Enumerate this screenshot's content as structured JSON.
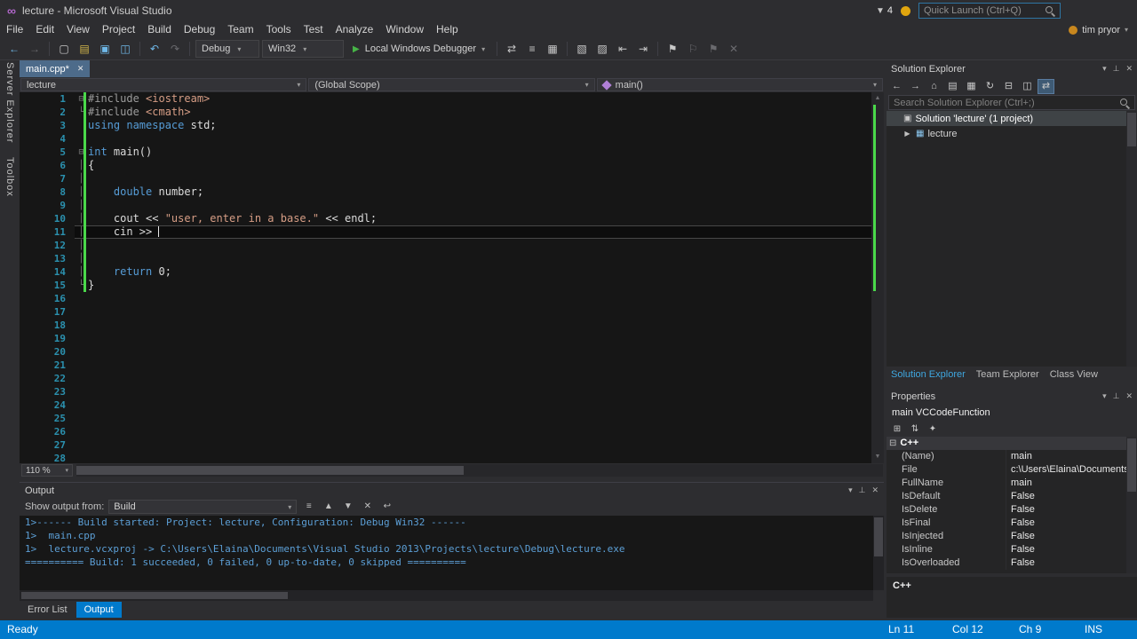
{
  "title_bar": {
    "title": "lecture - Microsoft Visual Studio",
    "notif_count": "4",
    "quick_launch_placeholder": "Quick Launch (Ctrl+Q)"
  },
  "menu": {
    "items": [
      "File",
      "Edit",
      "View",
      "Project",
      "Build",
      "Debug",
      "Team",
      "Tools",
      "Test",
      "Analyze",
      "Window",
      "Help"
    ],
    "user": "tim pryor"
  },
  "toolbar": {
    "debug_config": "Debug",
    "platform": "Win32",
    "run_label": "Local Windows Debugger"
  },
  "side_tabs": [
    "Server Explorer",
    "Toolbox"
  ],
  "editor": {
    "tab": "main.cpp*",
    "nav": {
      "project": "lecture",
      "scope": "(Global Scope)",
      "member": "main()"
    },
    "zoom": "110 %",
    "lines": [
      {
        "n": 1,
        "fold": "box",
        "seg": [
          {
            "t": "#include ",
            "c": "pp"
          },
          {
            "t": "<iostream>",
            "c": "str"
          }
        ]
      },
      {
        "n": 2,
        "fold": "end",
        "seg": [
          {
            "t": "#include ",
            "c": "pp"
          },
          {
            "t": "<cmath>",
            "c": "str"
          }
        ]
      },
      {
        "n": 3,
        "fold": "",
        "seg": [
          {
            "t": "using",
            "c": "kw"
          },
          {
            "t": " ",
            "c": "pl"
          },
          {
            "t": "namespace",
            "c": "kw"
          },
          {
            "t": " std;",
            "c": "pl"
          }
        ]
      },
      {
        "n": 4,
        "fold": "",
        "seg": []
      },
      {
        "n": 5,
        "fold": "box",
        "seg": [
          {
            "t": "int",
            "c": "kw"
          },
          {
            "t": " main()",
            "c": "pl"
          }
        ]
      },
      {
        "n": 6,
        "fold": "line",
        "seg": [
          {
            "t": "{",
            "c": "pl"
          }
        ]
      },
      {
        "n": 7,
        "fold": "line",
        "seg": []
      },
      {
        "n": 8,
        "fold": "line",
        "seg": [
          {
            "t": "    ",
            "c": "pl"
          },
          {
            "t": "double",
            "c": "kw"
          },
          {
            "t": " number;",
            "c": "pl"
          }
        ]
      },
      {
        "n": 9,
        "fold": "line",
        "seg": []
      },
      {
        "n": 10,
        "fold": "line",
        "seg": [
          {
            "t": "    cout << ",
            "c": "pl"
          },
          {
            "t": "\"user, enter in a base.\"",
            "c": "str"
          },
          {
            "t": " << endl;",
            "c": "pl"
          }
        ]
      },
      {
        "n": 11,
        "fold": "line",
        "current": true,
        "seg": [
          {
            "t": "    cin >> ",
            "c": "pl"
          }
        ]
      },
      {
        "n": 12,
        "fold": "line",
        "seg": []
      },
      {
        "n": 13,
        "fold": "line",
        "seg": []
      },
      {
        "n": 14,
        "fold": "line",
        "seg": [
          {
            "t": "    ",
            "c": "pl"
          },
          {
            "t": "return",
            "c": "kw"
          },
          {
            "t": " 0;",
            "c": "pl"
          }
        ]
      },
      {
        "n": 15,
        "fold": "end",
        "seg": [
          {
            "t": "}",
            "c": "pl"
          }
        ]
      },
      {
        "n": 16,
        "fold": "",
        "seg": []
      },
      {
        "n": 17,
        "fold": "",
        "seg": []
      },
      {
        "n": 18,
        "fold": "",
        "seg": []
      },
      {
        "n": 19,
        "fold": "",
        "seg": []
      },
      {
        "n": 20,
        "fold": "",
        "seg": []
      },
      {
        "n": 21,
        "fold": "",
        "seg": []
      },
      {
        "n": 22,
        "fold": "",
        "seg": []
      },
      {
        "n": 23,
        "fold": "",
        "seg": []
      },
      {
        "n": 24,
        "fold": "",
        "seg": []
      },
      {
        "n": 25,
        "fold": "",
        "seg": []
      },
      {
        "n": 26,
        "fold": "",
        "seg": []
      },
      {
        "n": 27,
        "fold": "",
        "seg": []
      },
      {
        "n": 28,
        "fold": "",
        "seg": []
      }
    ]
  },
  "output": {
    "title": "Output",
    "show_output_from_label": "Show output from:",
    "source": "Build",
    "lines": [
      "1>------ Build started: Project: lecture, Configuration: Debug Win32 ------",
      "1>  main.cpp",
      "1>  lecture.vcxproj -> C:\\Users\\Elaina\\Documents\\Visual Studio 2013\\Projects\\lecture\\Debug\\lecture.exe",
      "========== Build: 1 succeeded, 0 failed, 0 up-to-date, 0 skipped =========="
    ]
  },
  "bottom_tabs": [
    {
      "label": "Error List",
      "active": false
    },
    {
      "label": "Output",
      "active": true
    }
  ],
  "solution_explorer": {
    "title": "Solution Explorer",
    "search_placeholder": "Search Solution Explorer (Ctrl+;)",
    "items": [
      {
        "label": "Solution 'lecture' (1 project)",
        "indent": 0,
        "selected": true,
        "icon": "solution",
        "expander": ""
      },
      {
        "label": "lecture",
        "indent": 1,
        "selected": false,
        "icon": "project",
        "expander": "▶"
      }
    ],
    "tabs": [
      {
        "label": "Solution Explorer",
        "active": true
      },
      {
        "label": "Team Explorer",
        "active": false
      },
      {
        "label": "Class View",
        "active": false
      }
    ]
  },
  "properties": {
    "title": "Properties",
    "object": "main VCCodeFunction",
    "category": "C++",
    "rows": [
      {
        "name": "(Name)",
        "value": "main"
      },
      {
        "name": "File",
        "value": "c:\\Users\\Elaina\\Documents\\"
      },
      {
        "name": "FullName",
        "value": "main"
      },
      {
        "name": "IsDefault",
        "value": "False"
      },
      {
        "name": "IsDelete",
        "value": "False"
      },
      {
        "name": "IsFinal",
        "value": "False"
      },
      {
        "name": "IsInjected",
        "value": "False"
      },
      {
        "name": "IsInline",
        "value": "False"
      },
      {
        "name": "IsOverloaded",
        "value": "False"
      }
    ],
    "description_title": "C++"
  },
  "status_bar": {
    "status": "Ready",
    "line": "Ln 11",
    "col": "Col 12",
    "ch": "Ch 9",
    "mode": "INS"
  },
  "icons": {
    "vs_logo": "∞",
    "notif_caret": "▼",
    "back": "←",
    "forward": "→",
    "new_file": "▢",
    "open": "▤",
    "save": "▣",
    "save_all": "◫",
    "undo": "↶",
    "redo": "↷",
    "play": "▶",
    "dropdown": "▾",
    "attach": "⇄",
    "threads": "≡",
    "memory": "▦",
    "comment": "▧",
    "uncomment": "▨",
    "outdent": "⇤",
    "indent": "⇥",
    "flag": "⚑",
    "flag_outline": "⚐",
    "flag_clear": "✕",
    "close": "✕",
    "pin": "⊥",
    "up": "▲",
    "down": "▼",
    "home": "⌂",
    "refresh": "↻",
    "collapse_all": "⊟",
    "show_all": "▦",
    "props": "▤",
    "sync": "⇄",
    "pending": "◫",
    "categorized": "⊞",
    "alphabetical": "⇅",
    "wrench": "✦",
    "expand_minus": "⊟",
    "solution": "▣",
    "project": "▦",
    "find": "≡",
    "prev_msg": "▲",
    "next_msg": "▼",
    "word_wrap": "↩"
  }
}
